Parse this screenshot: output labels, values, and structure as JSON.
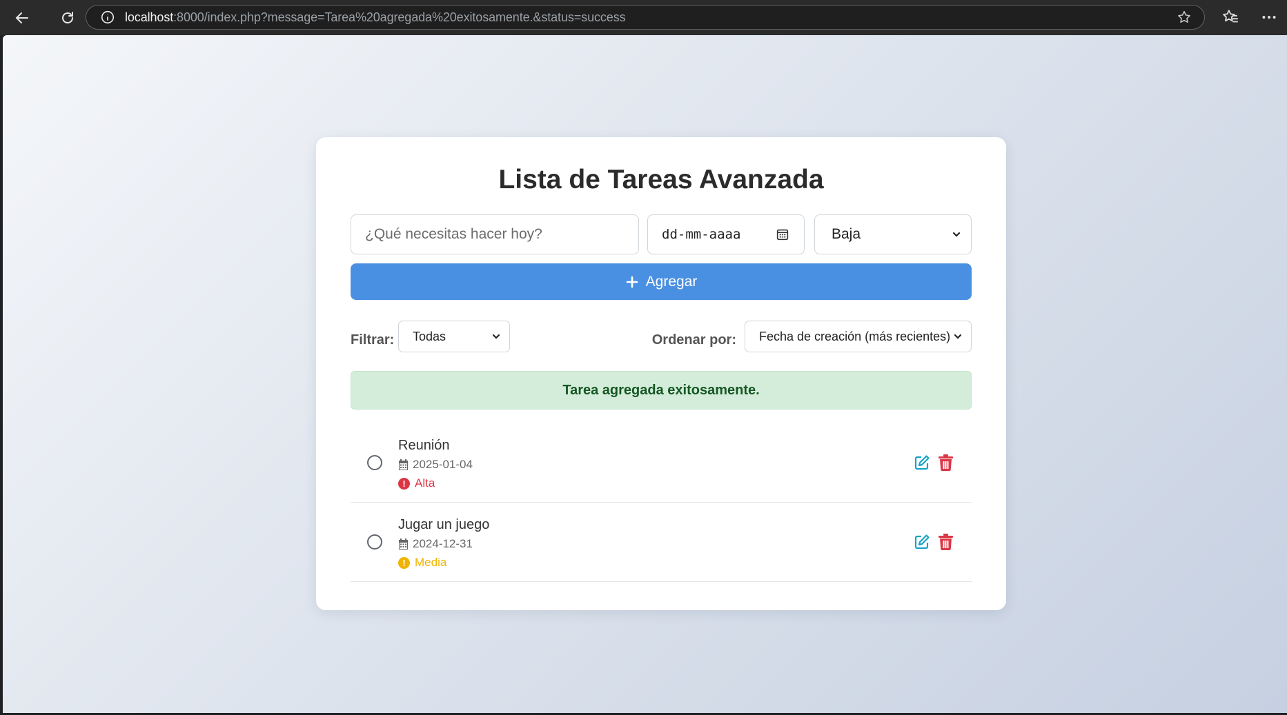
{
  "browser": {
    "url_host": "localhost",
    "url_rest": ":8000/index.php?message=Tarea%20agregada%20exitosamente.&status=success"
  },
  "page": {
    "title": "Lista de Tareas Avanzada",
    "task_input_placeholder": "¿Qué necesitas hacer hoy?",
    "date_placeholder": "dd-mm-aaaa",
    "priority_selected": "Baja",
    "add_label": "Agregar",
    "filter_label": "Filtrar:",
    "filter_selected": "Todas",
    "sort_label": "Ordenar por:",
    "sort_selected": "Fecha de creación (más recientes)",
    "alert_message": "Tarea agregada exitosamente."
  },
  "colors": {
    "primary": "#4a90e2",
    "alta": "#dc3545",
    "media": "#f0b400",
    "success_bg": "#d4edda",
    "success_text": "#155724",
    "edit": "#17a2c8"
  },
  "tasks": [
    {
      "title": "Reunión",
      "date": "2025-01-04",
      "priority": "Alta",
      "priority_color": "#dc3545",
      "priority_icon": "exclamation-circle-icon"
    },
    {
      "title": "Jugar un juego",
      "date": "2024-12-31",
      "priority": "Media",
      "priority_color": "#f0b400",
      "priority_icon": "exclamation-circle-icon"
    }
  ]
}
